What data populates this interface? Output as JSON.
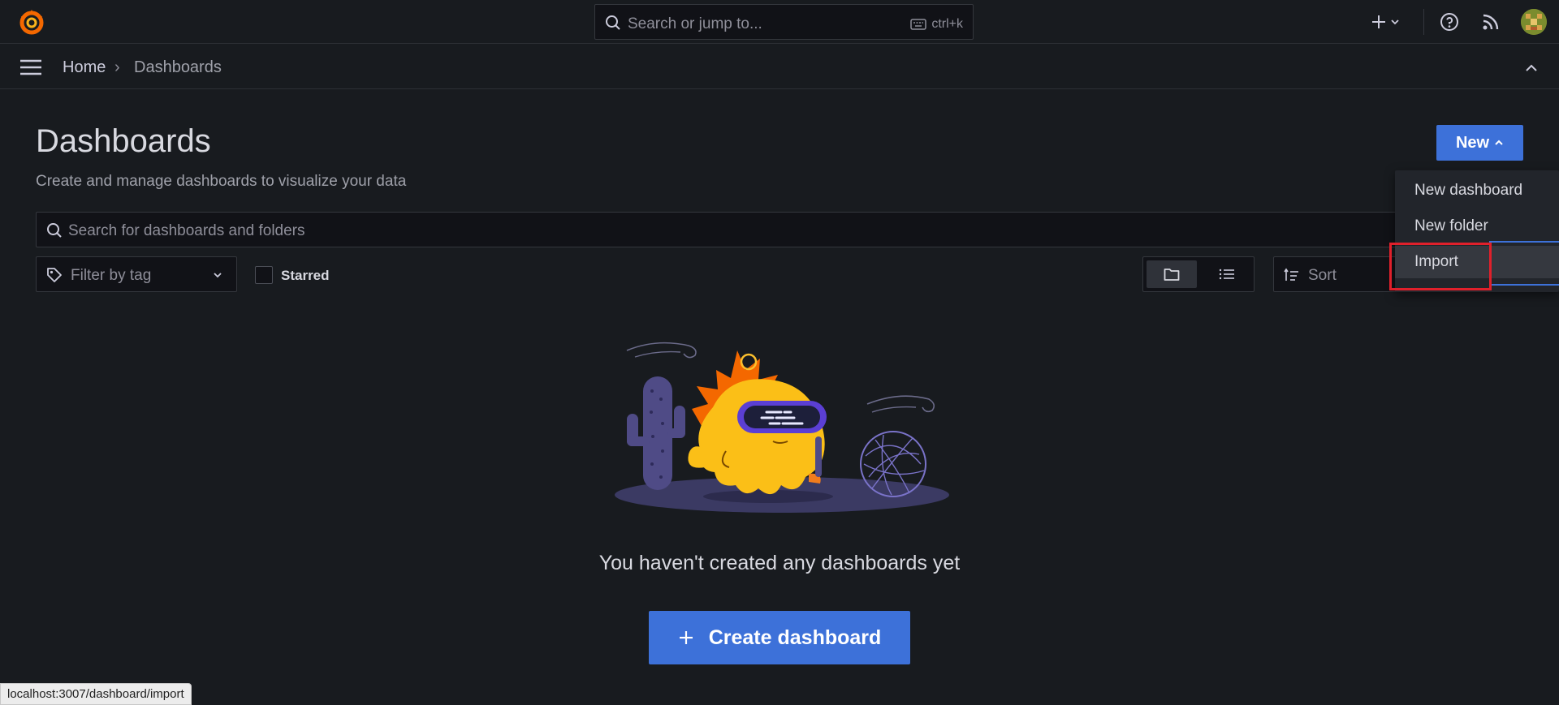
{
  "topbar": {
    "logo_icon": "grafana-logo-icon",
    "search_placeholder": "Search or jump to...",
    "search_shortcut": "ctrl+k",
    "plus_icon": "plus-icon",
    "help_icon": "help-icon",
    "news_icon": "rss-icon",
    "avatar_icon": "user-avatar"
  },
  "breadcrumb": {
    "home": "Home",
    "separator": "›",
    "current": "Dashboards"
  },
  "page": {
    "title": "Dashboards",
    "subtitle": "Create and manage dashboards to visualize your data",
    "new_button": "New"
  },
  "filters": {
    "search_placeholder": "Search for dashboards and folders",
    "tag_placeholder": "Filter by tag",
    "starred_label": "Starred",
    "sort_placeholder": "Sort",
    "view_modes": [
      "folder-view",
      "list-view"
    ]
  },
  "new_menu": {
    "items": [
      "New dashboard",
      "New folder",
      "Import"
    ],
    "highlighted": "Import"
  },
  "empty_state": {
    "message": "You haven't created any dashboards yet",
    "create_button": "Create dashboard"
  },
  "status_bar": {
    "url": "localhost:3007/dashboard/import"
  },
  "colors": {
    "background": "#181b1f",
    "primary": "#3d71d9",
    "highlight_border": "#e0202b"
  }
}
